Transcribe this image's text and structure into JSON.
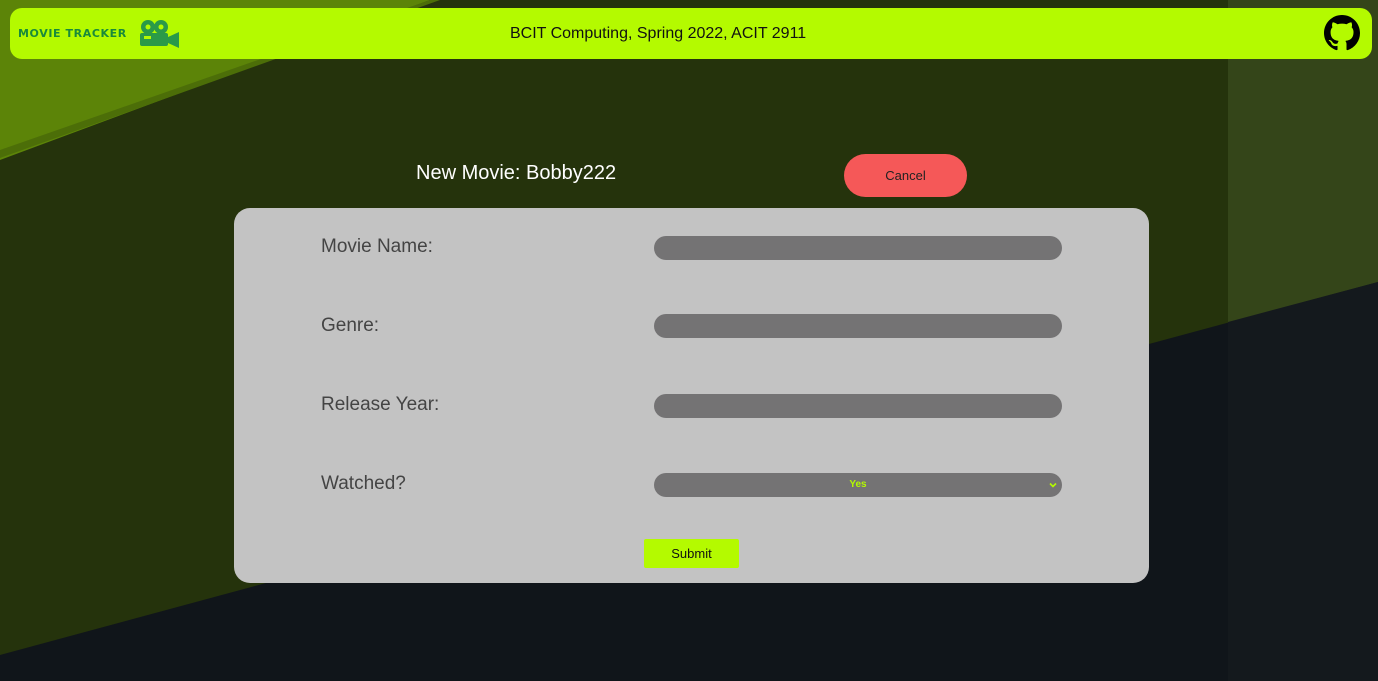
{
  "header": {
    "brand": "MOVIE TRACKER",
    "course": "BCIT Computing, Spring 2022, ACIT 2911"
  },
  "page": {
    "title": "New Movie: Bobby222",
    "cancel_label": "Cancel"
  },
  "form": {
    "movie_name_label": "Movie Name:",
    "movie_name_value": "",
    "genre_label": "Genre:",
    "genre_value": "",
    "release_year_label": "Release Year:",
    "release_year_value": "",
    "watched_label": "Watched?",
    "watched_value": "Yes",
    "submit_label": "Submit"
  },
  "colors": {
    "accent": "#b4fa00",
    "cancel": "#f55858",
    "card": "#c3c3c3",
    "input": "#747374",
    "background_olive": "#25330c",
    "background_dark": "#10151a"
  },
  "icons": {
    "brand": "film-camera-icon",
    "repo": "github-icon",
    "select": "chevron-down-icon"
  }
}
